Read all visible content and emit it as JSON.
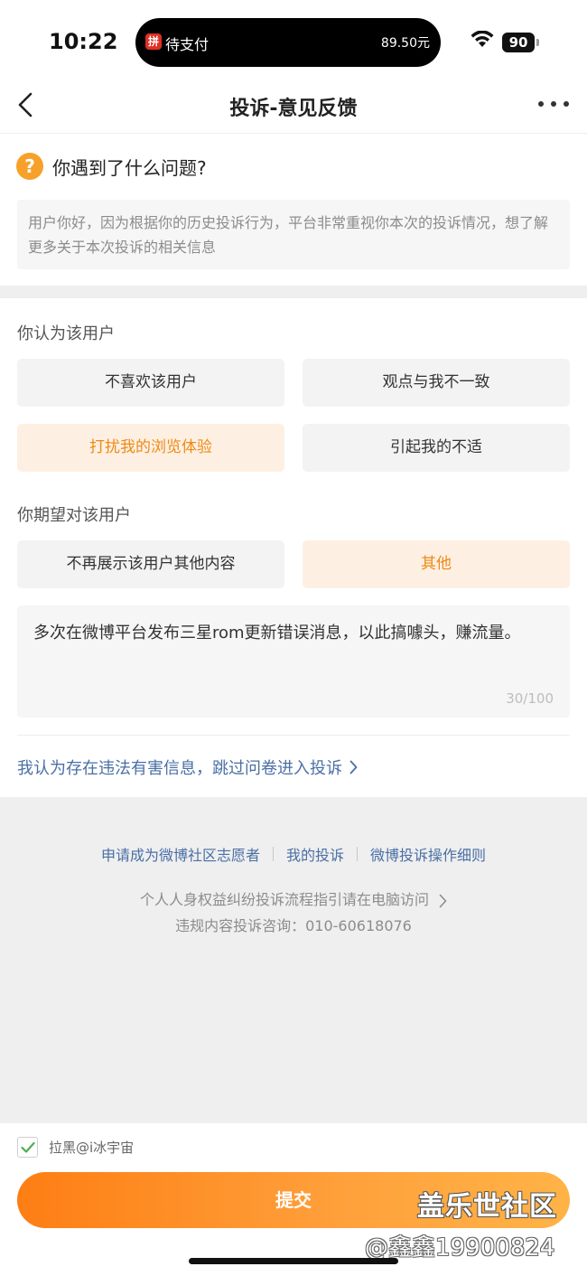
{
  "status_bar": {
    "time": "10:22",
    "island_left": "待支付",
    "island_right": "89.50元",
    "battery": "90"
  },
  "nav": {
    "title": "投诉-意见反馈"
  },
  "question": {
    "icon_glyph": "?",
    "title": "你遇到了什么问题?",
    "notice": "用户你好，因为根据你的历史投诉行为，平台非常重视你本次的投诉情况，想了解更多关于本次投诉的相关信息"
  },
  "section1": {
    "label": "你认为该用户",
    "options": [
      {
        "label": "不喜欢该用户",
        "selected": false
      },
      {
        "label": "观点与我不一致",
        "selected": false
      },
      {
        "label": "打扰我的浏览体验",
        "selected": true
      },
      {
        "label": "引起我的不适",
        "selected": false
      }
    ]
  },
  "section2": {
    "label": "你期望对该用户",
    "options": [
      {
        "label": "不再展示该用户其他内容",
        "selected": false
      },
      {
        "label": "其他",
        "selected": true
      }
    ]
  },
  "comment": {
    "text": "多次在微博平台发布三星rom更新错误消息，以此搞噱头，赚流量。",
    "count": "30/100"
  },
  "skip_link": "我认为存在违法有害信息，跳过问卷进入投诉",
  "footer": {
    "links": [
      "申请成为微博社区志愿者",
      "我的投诉",
      "微博投诉操作细则"
    ],
    "guide": "个人人身权益纠纷投诉流程指引请在电脑访问",
    "hotline": "违规内容投诉咨询：010-60618076"
  },
  "block_checkbox": {
    "label": "拉黑@i冰宇宙",
    "checked": true
  },
  "submit_label": "提交",
  "watermark": {
    "main": "盖乐世社区",
    "sub": "@鑫鑫19900824"
  },
  "colors": {
    "accent": "#ee8a17",
    "link": "#4a6fa5",
    "selected_bg": "#fdf0e3",
    "check": "#4caf50"
  }
}
